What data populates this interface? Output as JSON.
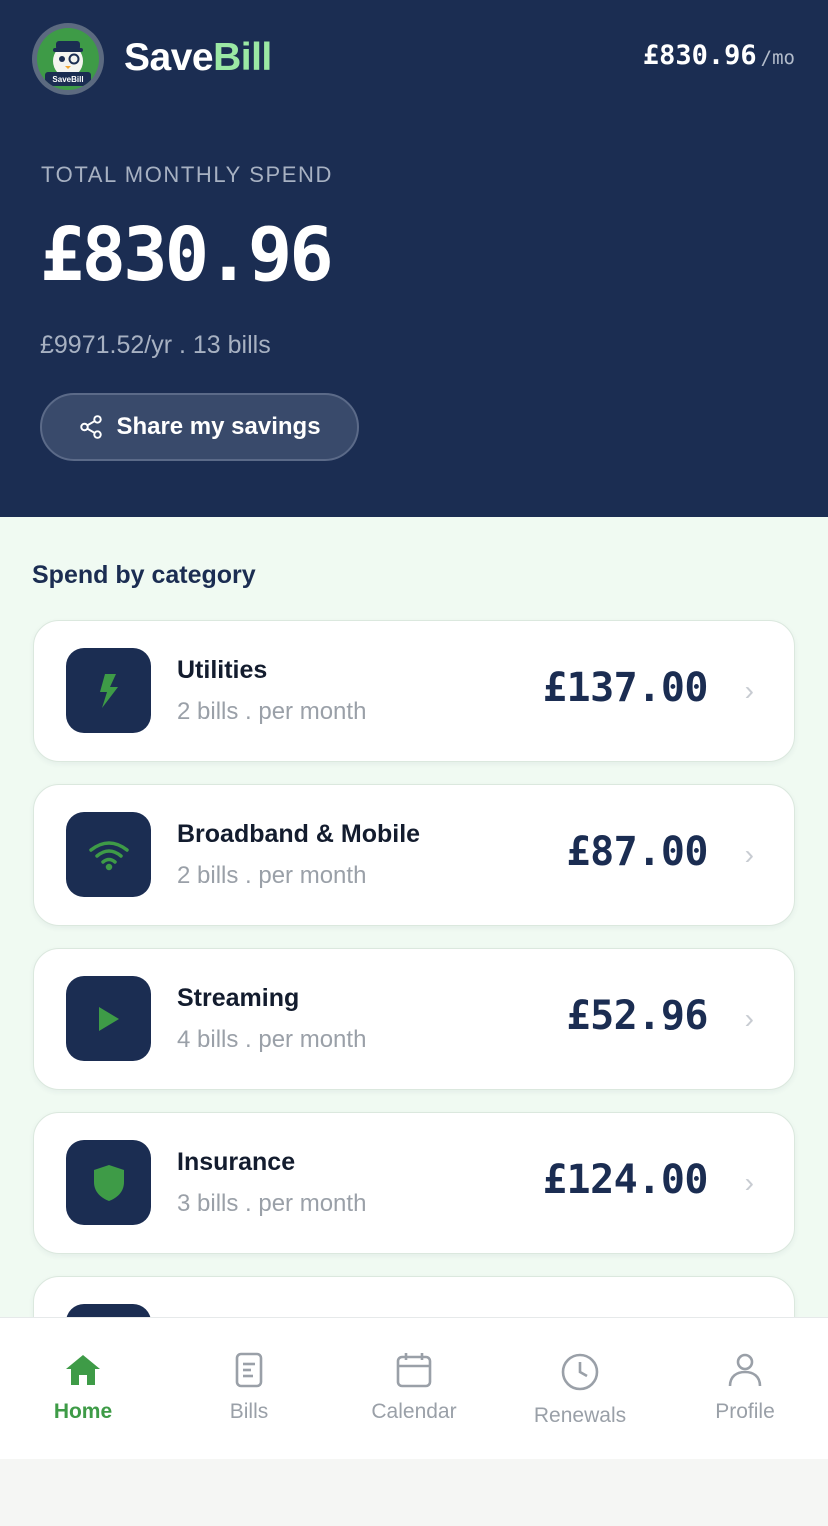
{
  "app": {
    "brand_part1": "Save",
    "brand_part2": "Bill",
    "logo_text": "SaveBill",
    "header_amount": "£830.96",
    "header_unit": "/mo"
  },
  "summary": {
    "label": "TOTAL MONTHLY SPEND",
    "value": "£830.96",
    "subline": "£9971.52/yr . 13 bills",
    "share_label": "Share my savings"
  },
  "categories": {
    "title": "Spend by category",
    "items": [
      {
        "name": "Utilities",
        "sub": "2 bills . per month",
        "amount": "£137.00",
        "icon": "lightning-icon"
      },
      {
        "name": "Broadband & Mobile",
        "sub": "2 bills . per month",
        "amount": "£87.00",
        "icon": "wifi-icon"
      },
      {
        "name": "Streaming",
        "sub": "4 bills . per month",
        "amount": "£52.96",
        "icon": "play-icon"
      },
      {
        "name": "Insurance",
        "sub": "3 bills . per month",
        "amount": "£124.00",
        "icon": "shield-icon"
      }
    ]
  },
  "nav": {
    "items": [
      {
        "label": "Home",
        "icon": "home-icon",
        "active": true
      },
      {
        "label": "Bills",
        "icon": "document-icon",
        "active": false
      },
      {
        "label": "Calendar",
        "icon": "calendar-icon",
        "active": false
      },
      {
        "label": "Renewals",
        "icon": "clock-icon",
        "active": false
      },
      {
        "label": "Profile",
        "icon": "person-icon",
        "active": false
      }
    ]
  },
  "colors": {
    "primary": "#1b2d52",
    "accent": "#3e9b47",
    "brand_accent": "#9be8a4",
    "background": "#f0faf2"
  }
}
